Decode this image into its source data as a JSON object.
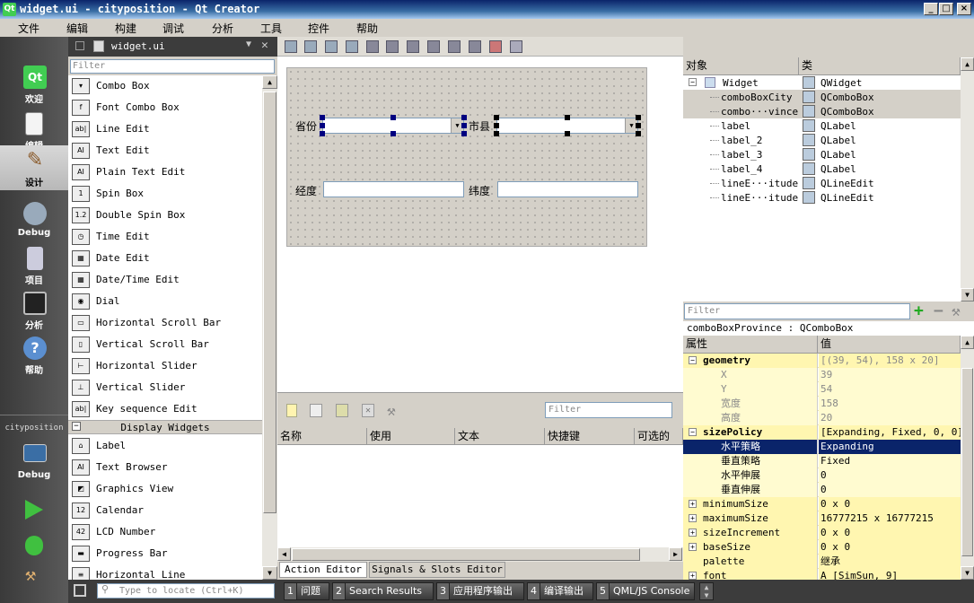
{
  "window": {
    "title": "widget.ui - cityposition - Qt Creator",
    "app_icon_text": "Qt"
  },
  "menubar": [
    "文件",
    "编辑",
    "构建",
    "调试",
    "分析",
    "工具",
    "控件",
    "帮助"
  ],
  "modes": [
    {
      "label": "欢迎",
      "icon": "qt-logo-icon"
    },
    {
      "label": "编辑",
      "icon": "document-icon"
    },
    {
      "label": "设计",
      "icon": "pencil-icon",
      "active": true
    },
    {
      "label": "Debug",
      "icon": "debug-bug-icon"
    },
    {
      "label": "项目",
      "icon": "project-wrench-icon"
    },
    {
      "label": "分析",
      "icon": "oscilloscope-icon"
    },
    {
      "label": "帮助",
      "icon": "help-icon"
    }
  ],
  "kit": {
    "project": "cityposition",
    "config": "Debug"
  },
  "editor": {
    "file": "widget.ui"
  },
  "widget_box": {
    "filter_placeholder": "Filter",
    "items": [
      {
        "label": "Combo Box",
        "icon": "combo-box-icon"
      },
      {
        "label": "Font Combo Box",
        "icon": "font-combo-icon"
      },
      {
        "label": "Line Edit",
        "icon": "line-edit-icon"
      },
      {
        "label": "Text Edit",
        "icon": "text-edit-icon"
      },
      {
        "label": "Plain Text Edit",
        "icon": "plain-text-edit-icon"
      },
      {
        "label": "Spin Box",
        "icon": "spin-box-icon"
      },
      {
        "label": "Double Spin Box",
        "icon": "double-spin-box-icon"
      },
      {
        "label": "Time Edit",
        "icon": "clock-icon"
      },
      {
        "label": "Date Edit",
        "icon": "calendar-grid-icon"
      },
      {
        "label": "Date/Time Edit",
        "icon": "datetime-icon"
      },
      {
        "label": "Dial",
        "icon": "dial-icon"
      },
      {
        "label": "Horizontal Scroll Bar",
        "icon": "hscrollbar-icon"
      },
      {
        "label": "Vertical Scroll Bar",
        "icon": "vscrollbar-icon"
      },
      {
        "label": "Horizontal Slider",
        "icon": "hslider-icon"
      },
      {
        "label": "Vertical Slider",
        "icon": "vslider-icon"
      },
      {
        "label": "Key sequence Edit",
        "icon": "keyseq-icon"
      }
    ],
    "category": "Display Widgets",
    "display_items": [
      {
        "label": "Label",
        "icon": "label-tag-icon"
      },
      {
        "label": "Text Browser",
        "icon": "text-browser-icon"
      },
      {
        "label": "Graphics View",
        "icon": "graphics-view-icon"
      },
      {
        "label": "Calendar",
        "icon": "calendar-icon"
      },
      {
        "label": "LCD Number",
        "icon": "lcd-icon"
      },
      {
        "label": "Progress Bar",
        "icon": "progress-bar-icon"
      },
      {
        "label": "Horizontal Line",
        "icon": "hline-icon"
      }
    ],
    "icon_glyphs": [
      "▾",
      "f",
      "ab|",
      "AI",
      "AI",
      "1",
      "1.2",
      "◷",
      "▦",
      "▦",
      "◉",
      "▭",
      "▯",
      "⊢",
      "⊥",
      "ab|"
    ],
    "display_icon_glyphs": [
      "⌂",
      "AI",
      "◩",
      "12",
      "42",
      "▬",
      "≡"
    ]
  },
  "form": {
    "label_province": "省份",
    "label_city": "市县",
    "label_longitude": "经度",
    "label_latitude": "纬度"
  },
  "action_editor": {
    "filter_placeholder": "Filter",
    "columns": [
      "名称",
      "使用",
      "文本",
      "快捷键",
      "可选的"
    ],
    "tabs": [
      "Action Editor",
      "Signals & Slots Editor"
    ]
  },
  "object_inspector": {
    "columns": [
      "对象",
      "类"
    ],
    "rows": [
      {
        "name": "Widget",
        "class": "QWidget",
        "level": 0,
        "expanded": true,
        "highlight": false,
        "icon": "widget-icon"
      },
      {
        "name": "comboBoxCity",
        "class": "QComboBox",
        "level": 1,
        "highlight": true,
        "icon": "combo-box-icon"
      },
      {
        "name": "combo···vince",
        "class": "QComboBox",
        "level": 1,
        "highlight": true,
        "icon": "combo-box-icon"
      },
      {
        "name": "label",
        "class": "QLabel",
        "level": 1,
        "highlight": false,
        "icon": "label-tag-icon"
      },
      {
        "name": "label_2",
        "class": "QLabel",
        "level": 1,
        "highlight": false,
        "icon": "label-tag-icon"
      },
      {
        "name": "label_3",
        "class": "QLabel",
        "level": 1,
        "highlight": false,
        "icon": "label-tag-icon"
      },
      {
        "name": "label_4",
        "class": "QLabel",
        "level": 1,
        "highlight": false,
        "icon": "label-tag-icon"
      },
      {
        "name": "lineE···itude",
        "class": "QLineEdit",
        "level": 1,
        "highlight": false,
        "icon": "line-edit-icon"
      },
      {
        "name": "lineE···itude",
        "class": "QLineEdit",
        "level": 1,
        "highlight": false,
        "icon": "line-edit-icon"
      }
    ]
  },
  "property_editor": {
    "filter_placeholder": "Filter",
    "object_label": "comboBoxProvince : QComboBox",
    "columns": [
      "属性",
      "值"
    ],
    "rows": [
      {
        "name": "geometry",
        "value": "[(39, 54), 158 x 20]",
        "bold": true,
        "expander": "minus",
        "indent": 0,
        "style": "yel2",
        "gray_value": true
      },
      {
        "name": "X",
        "value": "39",
        "indent": 1,
        "style": "yel1",
        "gray": true
      },
      {
        "name": "Y",
        "value": "54",
        "indent": 1,
        "style": "yel1",
        "gray": true
      },
      {
        "name": "宽度",
        "value": "158",
        "indent": 1,
        "style": "yel1",
        "gray": true
      },
      {
        "name": "高度",
        "value": "20",
        "indent": 1,
        "style": "yel1",
        "gray": true
      },
      {
        "name": "sizePolicy",
        "value": "[Expanding, Fixed, 0, 0]",
        "bold": true,
        "expander": "minus",
        "indent": 0,
        "style": "yel2"
      },
      {
        "name": "水平策略",
        "value": "Expanding",
        "indent": 1,
        "style": "sel"
      },
      {
        "name": "垂直策略",
        "value": "Fixed",
        "indent": 1,
        "style": "yel1"
      },
      {
        "name": "水平伸展",
        "value": "0",
        "indent": 1,
        "style": "yel1"
      },
      {
        "name": "垂直伸展",
        "value": "0",
        "indent": 1,
        "style": "yel1"
      },
      {
        "name": "minimumSize",
        "value": "0 x 0",
        "expander": "plus",
        "indent": 0,
        "style": "yel2"
      },
      {
        "name": "maximumSize",
        "value": "16777215 x 16777215",
        "expander": "plus",
        "indent": 0,
        "style": "yel2"
      },
      {
        "name": "sizeIncrement",
        "value": "0 x 0",
        "expander": "plus",
        "indent": 0,
        "style": "yel2"
      },
      {
        "name": "baseSize",
        "value": "0 x 0",
        "expander": "plus",
        "indent": 0,
        "style": "yel2"
      },
      {
        "name": "palette",
        "value": "继承",
        "indent": 0,
        "style": "yel2"
      },
      {
        "name": "font",
        "value": "A  [SimSun, 9]",
        "expander": "plus",
        "indent": 0,
        "style": "yel2"
      }
    ]
  },
  "bottom": {
    "locate_placeholder": "Type to locate (Ctrl+K)",
    "tabs": [
      {
        "num": "1",
        "label": "问题"
      },
      {
        "num": "2",
        "label": "Search Results"
      },
      {
        "num": "3",
        "label": "应用程序输出"
      },
      {
        "num": "4",
        "label": "编译输出"
      },
      {
        "num": "5",
        "label": "QML/JS Console"
      }
    ]
  }
}
